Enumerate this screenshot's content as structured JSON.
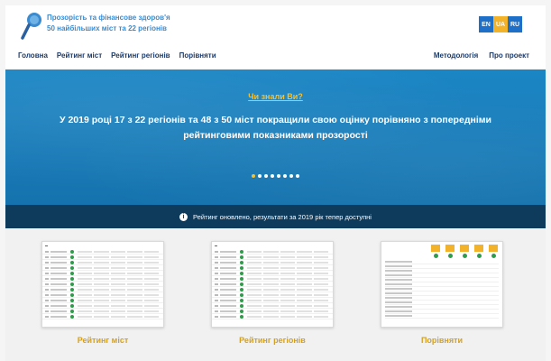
{
  "header": {
    "brand_line1": "Прозорість та фінансове здоров'я",
    "brand_line2": "50 найбільших міст та 22 регіонів",
    "languages": [
      "EN",
      "UA",
      "RU"
    ],
    "active_language": "UA"
  },
  "nav": {
    "left": [
      "Головна",
      "Рейтинг міст",
      "Рейтинг регіонів",
      "Порівняти"
    ],
    "right": [
      "Методологія",
      "Про проект"
    ]
  },
  "hero": {
    "question": "Чи знали Ви?",
    "text": "У 2019 році 17 з 22 регіонів та 48 з 50 міст покращили свою оцінку порівняно з попередніми рейтинговими показниками прозорості",
    "slide_count": 8,
    "active_slide": 1
  },
  "notice": {
    "text": "Рейтинг оновлено, результати за 2019 рік тепер доступні"
  },
  "cards": [
    {
      "label": "Рейтинг міст"
    },
    {
      "label": "Рейтинг регіонів"
    },
    {
      "label": "Порівняти"
    }
  ],
  "colors": {
    "brand_blue": "#1d6fc7",
    "accent_yellow": "#f2b22a",
    "hero_bg": "#1b86c5",
    "band_bg": "#0e3a5c",
    "good_green": "#2e9c4a"
  }
}
